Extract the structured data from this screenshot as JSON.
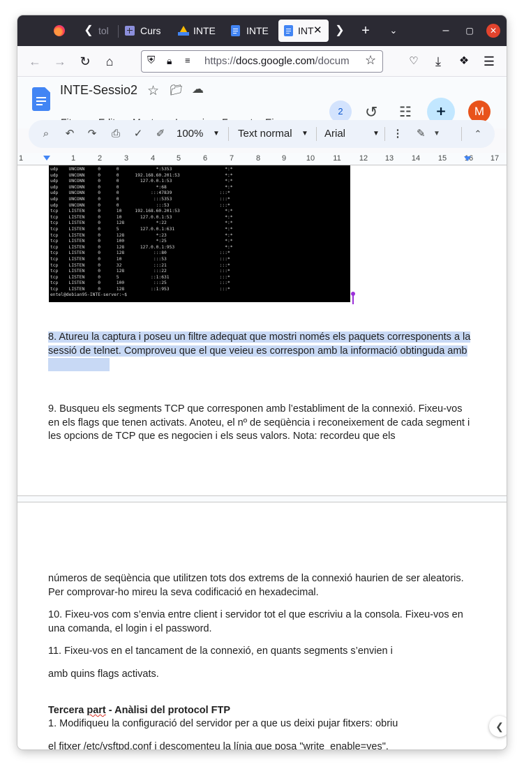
{
  "browser": {
    "tabs": [
      {
        "label": "tol"
      },
      {
        "label": "Curs"
      },
      {
        "label": "INTE"
      },
      {
        "label": "INTE"
      },
      {
        "label": "INT"
      }
    ],
    "url_prefix": "https://",
    "url_domain": "docs.google.com",
    "url_rest": "/docum"
  },
  "docs": {
    "title": "INTE-Sessio2",
    "menu": [
      "Fitxer",
      "Edita",
      "Mostra",
      "Insereix",
      "Format",
      "Eines",
      "..."
    ],
    "collaborators_count": "2",
    "avatar_letter": "M",
    "toolbar": {
      "zoom": "100%",
      "style": "Text normal",
      "font": "Arial"
    },
    "ruler": [
      "1",
      "1",
      "2",
      "3",
      "4",
      "5",
      "6",
      "7",
      "8",
      "9",
      "10",
      "11",
      "12",
      "13",
      "14",
      "15",
      "16",
      "17"
    ]
  },
  "terminal": {
    "lines": [
      "udp    UNCONN     0      0              *:5353                    *:*",
      "udp    UNCONN     0      0      192.168.60.201:53                 *:*",
      "udp    UNCONN     0      0        127.0.0.1:53                    *:*",
      "udp    UNCONN     0      0              *:68                      *:*",
      "udp    UNCONN     0      0            :::47839                  :::*",
      "udp    UNCONN     0      0             :::5353                  :::*",
      "udp    UNCONN     0      0              :::53                   :::*",
      "tcp    LISTEN     0      10     192.168.60.201:53                 *:*",
      "tcp    LISTEN     0      10       127.0.0.1:53                    *:*",
      "tcp    LISTEN     0      128            *:22                      *:*",
      "tcp    LISTEN     0      5        127.0.0.1:631                   *:*",
      "tcp    LISTEN     0      128            *:23                      *:*",
      "tcp    LISTEN     0      100            *:25                      *:*",
      "tcp    LISTEN     0      128      127.0.0.1:953                   *:*",
      "tcp    LISTEN     0      128           :::80                    :::*",
      "tcp    LISTEN     0      10            :::53                    :::*",
      "tcp    LISTEN     0      32            :::21                    :::*",
      "tcp    LISTEN     0      128           :::22                    :::*",
      "tcp    LISTEN     0      5            ::1:631                   :::*",
      "tcp    LISTEN     0      100           :::25                    :::*",
      "tcp    LISTEN     0      128          ::1:953                   :::*",
      "entel@debian95-INTE-server:~$"
    ]
  },
  "content": {
    "p8": "8. Atureu la captura i poseu un filtre adequat que mostri només els paquets corresponents a la sessió de telnet. Comproveu que el que veieu es correspon amb la informació obtinguda amb netstat.",
    "p9": "9. Busqueu els segments TCP que corresponen amb l’establiment de la connexió. Fixeu-vos en els flags que tenen activats. Anoteu, el nº de seqüència i reconeixement de cada segment i les opcions de TCP que es negocien i els seus valors. Nota: recordeu que els",
    "p9b": "números de seqüència que utilitzen tots dos extrems de la connexió haurien de ser aleatoris. Per comprovar-ho mireu la seva codificació en hexadecimal.",
    "p10": "10. Fixeu-vos com s’envia entre client i servidor tot el que escriviu a la consola. Fixeu-vos en una comanda, el login i el password.",
    "p11a": "11. Fixeu-vos en el tancament de la connexió, en quants segments s’envien i",
    "p11b": "amb quins flags activats.",
    "h3_a": "Tercera ",
    "h3_b": "part",
    "h3_c": " - Anàlisi del protocol FTP",
    "p1": "1. Modifiqueu la configuració del servidor per a que us deixi pujar fitxers: obriu",
    "p1b_a": "el fitxer /etc/vsftpd.conf i ",
    "p1b_b": "descomenteu",
    "p1b_c": " la ",
    "p1b_d": "línia",
    "p1b_e": " que posa \"write_enable=yes\"."
  }
}
